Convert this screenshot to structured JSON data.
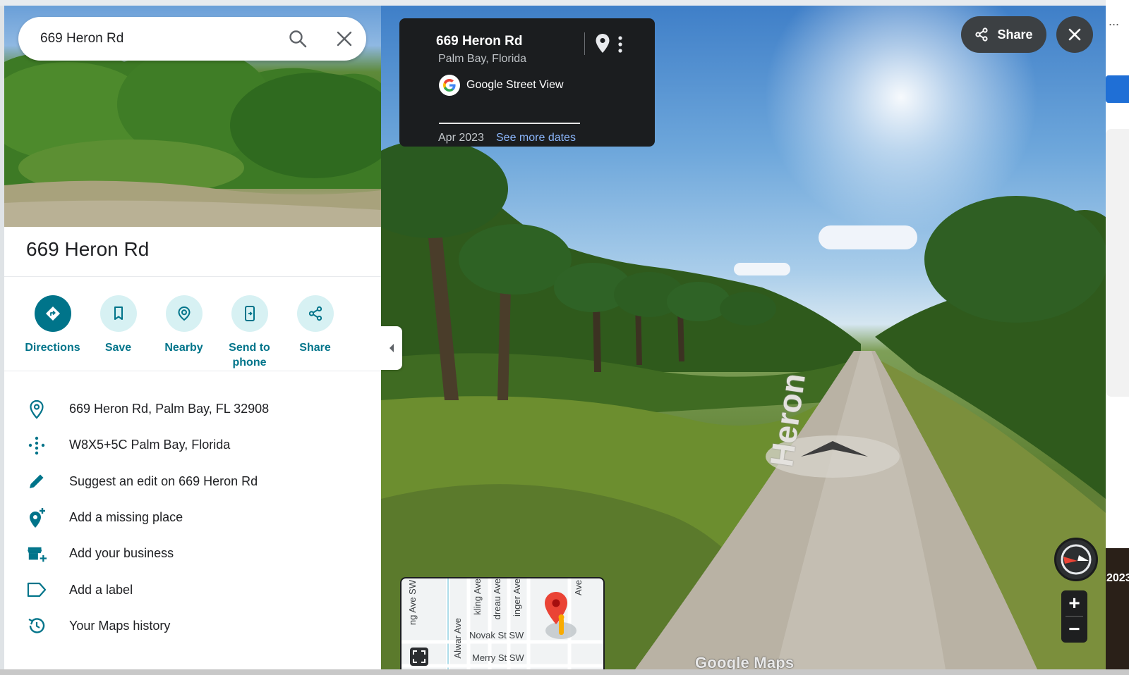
{
  "search": {
    "value": "669 Heron Rd"
  },
  "place": {
    "title": "669 Heron Rd"
  },
  "actions": [
    {
      "label": "Directions"
    },
    {
      "label": "Save"
    },
    {
      "label": "Nearby"
    },
    {
      "label": "Send to phone"
    },
    {
      "label": "Share"
    }
  ],
  "info": [
    {
      "icon": "location-pin-icon",
      "text": "669 Heron Rd, Palm Bay, FL 32908"
    },
    {
      "icon": "plus-code-icon",
      "text": "W8X5+5C Palm Bay, Florida"
    },
    {
      "icon": "pencil-icon",
      "text": "Suggest an edit on 669 Heron Rd"
    },
    {
      "icon": "add-place-icon",
      "text": "Add a missing place"
    },
    {
      "icon": "add-business-icon",
      "text": "Add your business"
    },
    {
      "icon": "label-icon",
      "text": "Add a label"
    },
    {
      "icon": "history-icon",
      "text": "Your Maps history"
    }
  ],
  "streetview": {
    "title": "669 Heron Rd",
    "subtitle": "Palm Bay, Florida",
    "source": "Google Street View",
    "date": "Apr 2023",
    "more_dates": "See more dates",
    "share_label": "Share",
    "road_name": "Heron",
    "watermark": "Google Maps"
  },
  "minimap": {
    "streets": [
      "ng Ave SW",
      "kling Ave",
      "dreau Ave",
      "inger Ave",
      "Ave",
      "Alwar Ave",
      "Novak St SW",
      "Merry St SW"
    ]
  },
  "right_edge": {
    "year": "2023",
    "ellipsis": "..."
  },
  "colors": {
    "accent": "#00748a",
    "accent_light": "#d7f1f3",
    "card_bg": "#1b1d1f",
    "link": "#8ab4f8",
    "pin_red": "#ea4335"
  }
}
